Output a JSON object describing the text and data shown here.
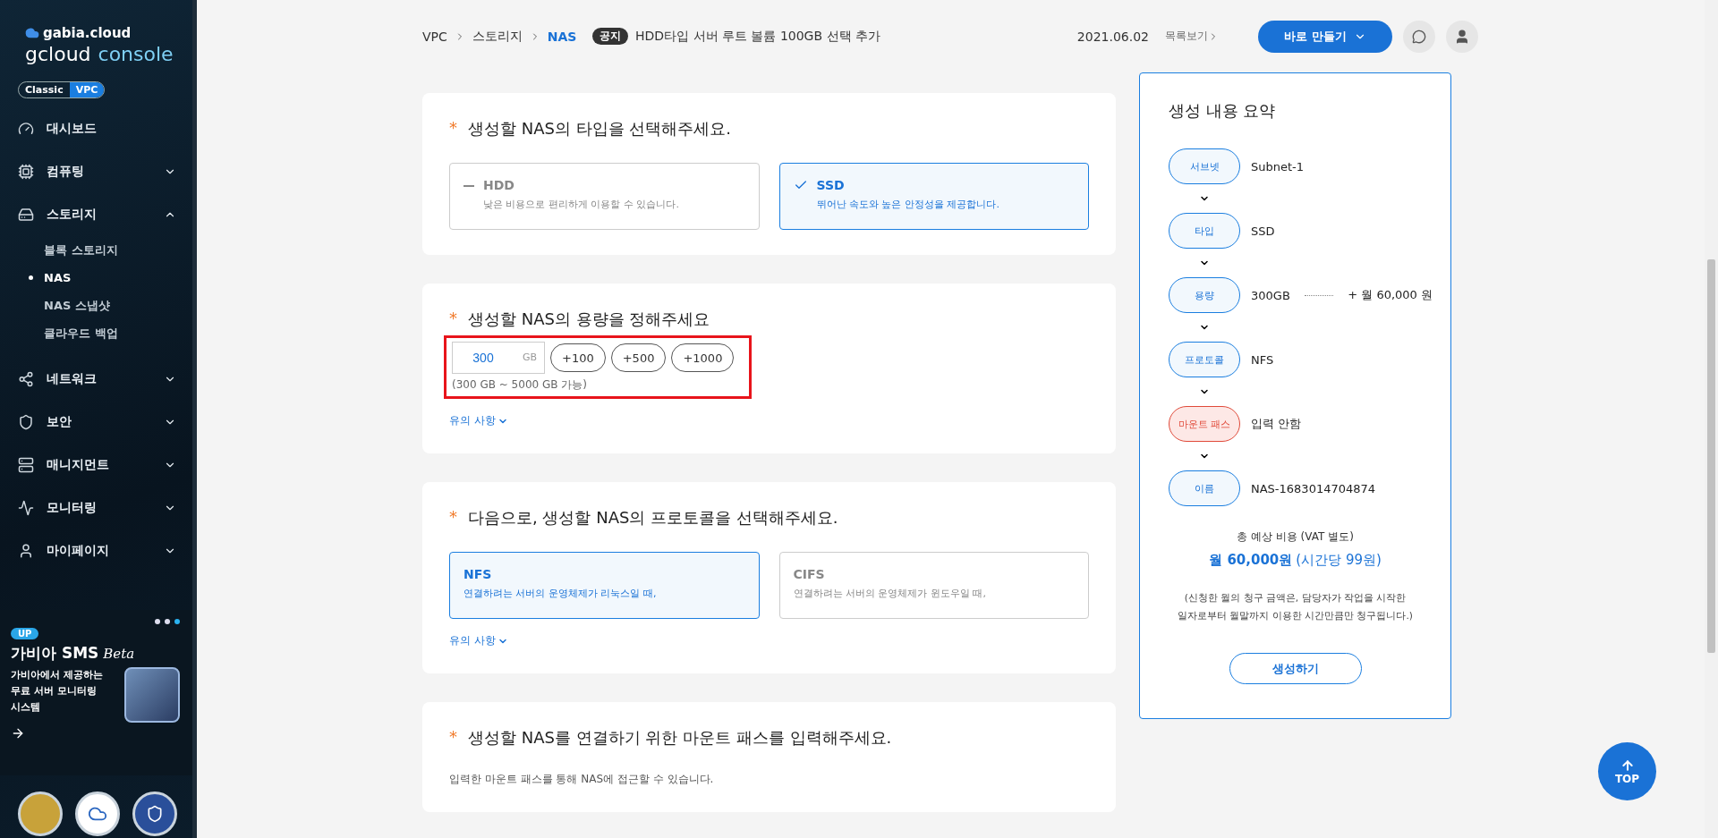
{
  "sidebar": {
    "brand": "gabia.cloud",
    "product_a": "gcloud",
    "product_b": "console",
    "mode_toggle": [
      {
        "label": "Classic",
        "selected": false
      },
      {
        "label": "VPC",
        "selected": true
      }
    ],
    "menu": [
      {
        "label": "대시보드"
      },
      {
        "label": "컴퓨팅",
        "expanded": false
      },
      {
        "label": "스토리지",
        "expanded": true,
        "children": [
          {
            "label": "블록 스토리지",
            "selected": false
          },
          {
            "label": "NAS",
            "selected": true
          },
          {
            "label": "NAS 스냅샷",
            "selected": false
          },
          {
            "label": "클라우드 백업",
            "selected": false
          }
        ]
      },
      {
        "label": "네트워크",
        "expanded": false
      },
      {
        "label": "보안",
        "expanded": false
      },
      {
        "label": "매니지먼트",
        "expanded": false
      },
      {
        "label": "모니터링",
        "expanded": false
      },
      {
        "label": "마이페이지",
        "expanded": false
      }
    ],
    "banner": {
      "dots": [
        {
          "selected": false
        },
        {
          "selected": false
        },
        {
          "selected": true
        }
      ],
      "tag": "UP",
      "title": "가비아 SMS",
      "title_suffix": "Beta",
      "lines": [
        "가비아에서 제공하는",
        "무료 서버 모니터링",
        "시스템"
      ]
    }
  },
  "topbar": {
    "breadcrumb": [
      {
        "label": "VPC",
        "selected": false
      },
      {
        "label": "스토리지",
        "selected": false
      },
      {
        "label": "NAS",
        "selected": true
      }
    ],
    "notice_tag": "공지",
    "notice": "HDD타입 서버 루트 볼륨 100GB 선택 추가",
    "notice_date": "2021.06.02",
    "notice_list": "목록보기",
    "create_button": "바로 만들기"
  },
  "sections": [
    {
      "kind": "options",
      "marker": "*",
      "title": "생성할 NAS의 타입을 선택해주세요.",
      "options": [
        {
          "name": "HDD",
          "desc": "낮은 비용으로 편리하게 이용할 수 있습니다.",
          "selected": false
        },
        {
          "name": "SSD",
          "desc": "뛰어난 속도와 높은 안정성을 제공합니다.",
          "selected": true
        }
      ]
    },
    {
      "kind": "capacity",
      "marker": "*",
      "title": "생성할 NAS의 용량을 정해주세요",
      "value": "300",
      "unit": "GB",
      "steps": [
        "+100",
        "+500",
        "+1000"
      ],
      "range": "(300 GB ~ 5000 GB 가능)",
      "highlighted": true,
      "note_link": "유의 사항"
    },
    {
      "kind": "options",
      "marker": "*",
      "title": "다음으로, 생성할 NAS의 프로토콜을 선택해주세요.",
      "options": [
        {
          "name": "NFS",
          "desc": "연결하려는 서버의 운영체제가 리눅스일 때,",
          "selected": true
        },
        {
          "name": "CIFS",
          "desc": "연결하려는 서버의 운영체제가 윈도우일 때,",
          "selected": false
        }
      ],
      "note_link": "유의 사항"
    },
    {
      "kind": "text",
      "marker": "*",
      "title": "생성할 NAS를 연결하기 위한 마운트 패스를 입력해주세요.",
      "desc": "입력한 마운트 패스를 통해 NAS에 접근할 수 있습니다."
    }
  ],
  "summary": {
    "title": "생성 내용 요약",
    "steps": [
      {
        "label": "서브넷",
        "value": "Subnet-1",
        "missing": false
      },
      {
        "label": "타입",
        "value": "SSD",
        "missing": false
      },
      {
        "label": "용량",
        "value": "300GB",
        "price": "+ 월 60,000 원",
        "missing": false
      },
      {
        "label": "프로토콜",
        "value": "NFS",
        "missing": false
      },
      {
        "label": "마운트 패스",
        "value": "입력 안함",
        "missing": true
      },
      {
        "label": "이름",
        "value": "NAS-1683014704874",
        "missing": false
      }
    ],
    "total_label": "총 예상 비용 (VAT 별도)",
    "total_price": "월 60,000원",
    "total_hourly": "(시간당 99원)",
    "note": [
      "(신청한 월의 청구 금액은, 담당자가 작업을 시작한",
      "일자로부터 월말까지 이용한 시간만큼만 청구됩니다.)"
    ],
    "create_button": "생성하기"
  },
  "top_button": "TOP"
}
